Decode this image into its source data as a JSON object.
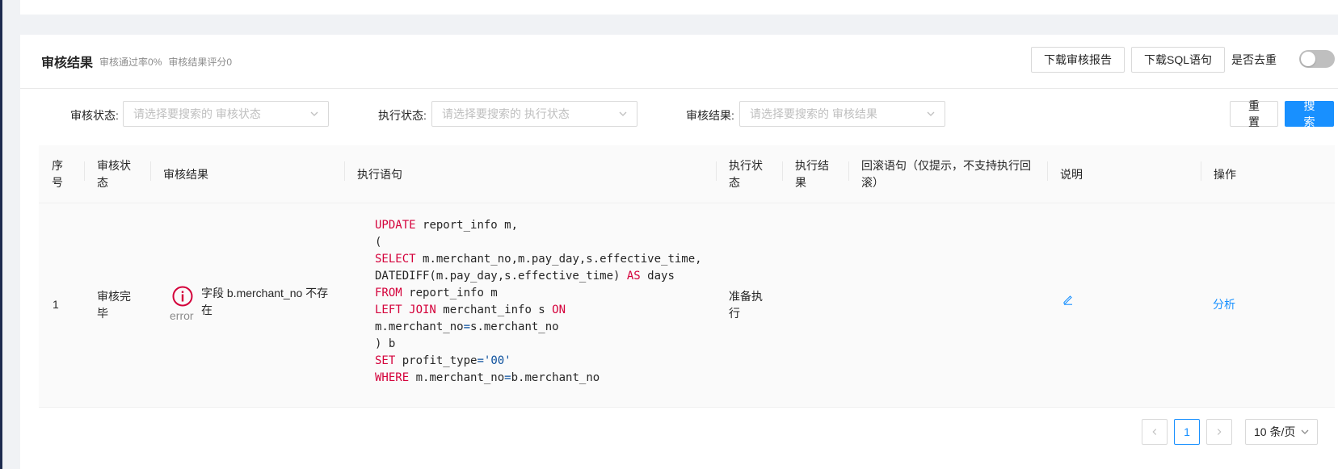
{
  "card": {
    "title": "审核结果",
    "pass_rate": "审核通过率0%",
    "score": "审核结果评分0",
    "download_report": "下载审核报告",
    "download_sql": "下载SQL语句",
    "dedup_label": "是否去重",
    "dedup_on": false
  },
  "filters": {
    "audit_status_label": "审核状态:",
    "audit_status_placeholder": "请选择要搜索的 审核状态",
    "exec_status_label": "执行状态:",
    "exec_status_placeholder": "请选择要搜索的 执行状态",
    "audit_result_label": "审核结果:",
    "audit_result_placeholder": "请选择要搜索的 审核结果",
    "reset": "重 置",
    "search": "搜 索"
  },
  "table": {
    "columns": [
      "序号",
      "审核状态",
      "审核结果",
      "执行语句",
      "执行状态",
      "执行结果",
      "回滚语句（仅提示，不支持执行回滚）",
      "说明",
      "操作"
    ],
    "rows": [
      {
        "index": "1",
        "audit_status": "审核完毕",
        "result_level": "error",
        "result_message": "字段 b.merchant_no 不存在",
        "sql_lines": [
          "UPDATE report_info m,",
          "(",
          "SELECT m.merchant_no,m.pay_day,s.effective_time,",
          "DATEDIFF(m.pay_day,s.effective_time) AS days",
          "FROM report_info m",
          "LEFT JOIN merchant_info s ON",
          "m.merchant_no=s.merchant_no",
          ") b",
          "SET profit_type='00'",
          "WHERE m.merchant_no=b.merchant_no"
        ],
        "exec_status": "准备执行",
        "exec_result": "",
        "rollback": "",
        "action": "分析"
      }
    ]
  },
  "pagination": {
    "current": "1",
    "page_size": "10 条/页"
  },
  "colors": {
    "primary": "#1890ff",
    "error": "#d4003a",
    "sidebar": "#1d2b4f"
  }
}
